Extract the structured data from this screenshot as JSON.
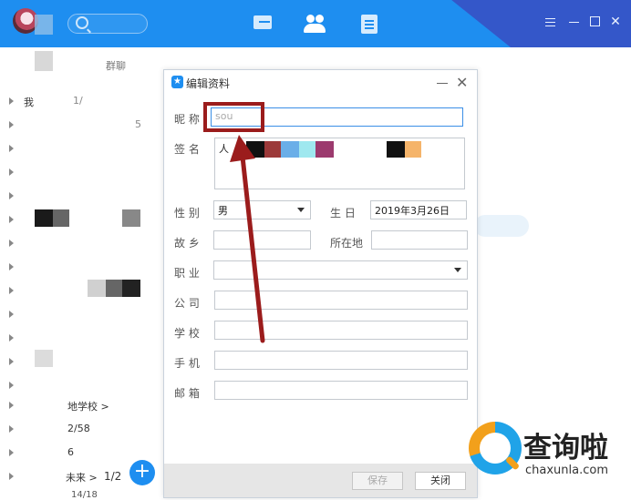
{
  "colors": {
    "accent": "#1e8ef0",
    "annotation": "#9b1c1c"
  },
  "topbar": {
    "icons": [
      "avatar",
      "search-icon",
      "message-icon",
      "contacts-icon",
      "space-icon",
      "menu-icon",
      "minimize-icon",
      "maximize-icon",
      "close-icon"
    ],
    "close_glyph": "✕"
  },
  "sidebar": {
    "tab_label": "群聊",
    "rows": [
      {
        "label": "我",
        "count": "1/"
      },
      {
        "label": "",
        "count": "5"
      },
      {
        "label": "地学校 >",
        "count": ""
      },
      {
        "label": "",
        "count": "2/58"
      },
      {
        "label": "",
        "count": "6"
      },
      {
        "label": "未来 >",
        "count": "1/2"
      },
      {
        "label": "",
        "count": "14/18"
      }
    ],
    "add_glyph": "+"
  },
  "dialog": {
    "title": "编辑资料",
    "logo_glyph": "★",
    "close_glyph": "✕",
    "fields": {
      "nickname": {
        "label": "昵 称",
        "value": "sou"
      },
      "signature": {
        "label": "签 名",
        "value": "人"
      },
      "gender": {
        "label": "性 别",
        "value": "男"
      },
      "birthday": {
        "label": "生 日",
        "value": "2019年3月26日"
      },
      "hometown": {
        "label": "故 乡",
        "value": ""
      },
      "location": {
        "label": "所在地",
        "value": ""
      },
      "occupation": {
        "label": "职 业",
        "value": ""
      },
      "company": {
        "label": "公 司",
        "value": ""
      },
      "school": {
        "label": "学 校",
        "value": ""
      },
      "phone": {
        "label": "手 机",
        "value": ""
      },
      "email": {
        "label": "邮 箱",
        "value": ""
      }
    },
    "save_label": "保存",
    "close_label": "关闭"
  },
  "watermark": {
    "text": "查询啦",
    "url": "chaxunla.com"
  }
}
